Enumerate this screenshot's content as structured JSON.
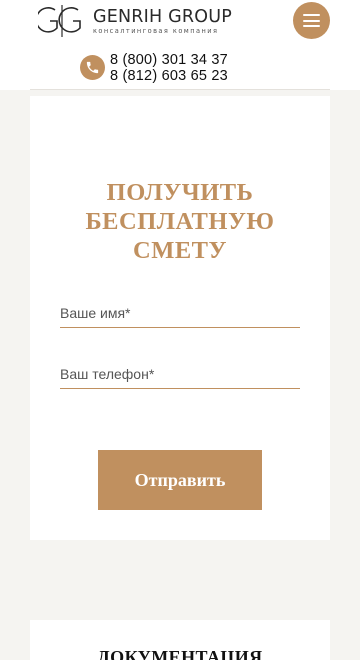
{
  "header": {
    "logo": {
      "mark": "GG",
      "name": "GENRIH GROUP",
      "tagline": "консалтинговая компания"
    },
    "phones": [
      "8 (800) 301 34 37",
      "8 (812) 603 65 23"
    ],
    "menu_icon": "hamburger-icon",
    "phone_icon": "phone-icon"
  },
  "form": {
    "title_lines": [
      "ПОЛУЧИТЬ",
      "БЕСПЛАТНУЮ",
      "СМЕТУ"
    ],
    "name_placeholder": "Ваше имя*",
    "phone_placeholder": "Ваш телефон*",
    "submit_label": "Отправить"
  },
  "next_section": {
    "title": "ДОКУМЕНТАЦИЯ"
  },
  "colors": {
    "accent": "#c0905f",
    "background": "#f5f4f1",
    "card": "#ffffff"
  }
}
